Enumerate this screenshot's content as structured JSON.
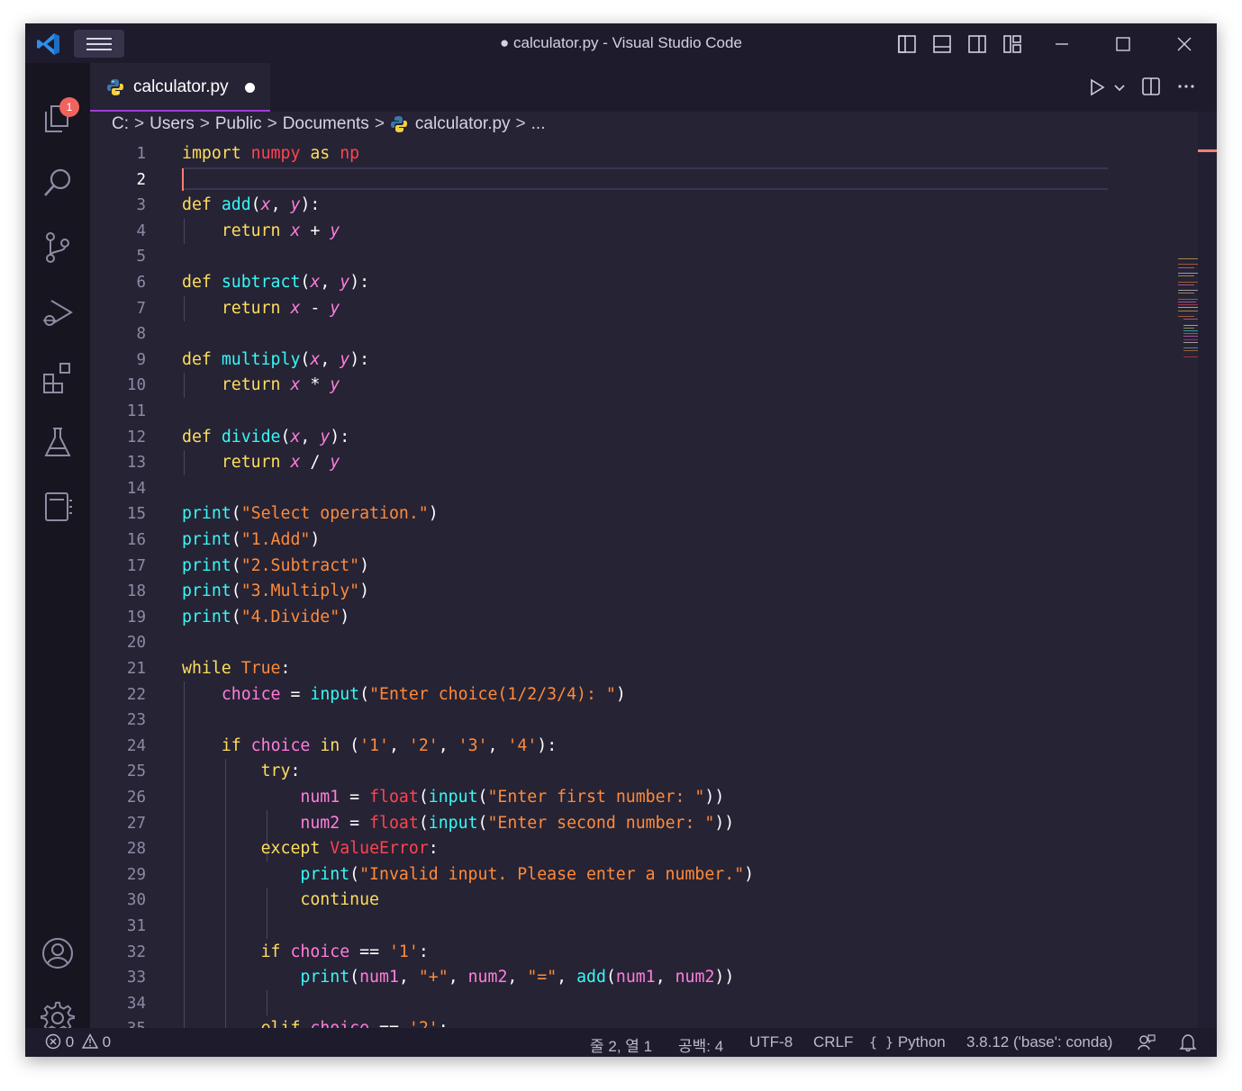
{
  "window": {
    "title": "● calculator.py - Visual Studio Code"
  },
  "activity_bar": {
    "explorer_badge": "1"
  },
  "tab": {
    "label": "calculator.py"
  },
  "breadcrumb": [
    "C:",
    "Users",
    "Public",
    "Documents",
    "calculator.py",
    "..."
  ],
  "editor": {
    "active_line": 2,
    "line_numbers": [
      "1",
      "2",
      "3",
      "4",
      "5",
      "6",
      "7",
      "8",
      "9",
      "10",
      "11",
      "12",
      "13",
      "14",
      "15",
      "16",
      "17",
      "18",
      "19",
      "20",
      "21",
      "22",
      "23",
      "24",
      "25",
      "26",
      "27",
      "28",
      "29",
      "30",
      "31",
      "32",
      "33",
      "34",
      "35"
    ]
  },
  "statusbar": {
    "errors": "0",
    "warnings": "0",
    "position": "줄 2, 열 1",
    "spaces": "공백: 4",
    "encoding": "UTF-8",
    "eol": "CRLF",
    "language": "Python",
    "interpreter": "3.8.12 ('base': conda)"
  },
  "colors": {
    "background": "#262335",
    "keyword": "#fede5d",
    "function": "#36f9f6",
    "string": "#ff8b39",
    "parameter": "#ff7edb",
    "module": "#fe4450",
    "accent": "#a03cd6"
  },
  "icons": [
    "vscode-logo-icon",
    "menu-icon",
    "layout-sidebar-left-icon",
    "layout-panel-icon",
    "layout-sidebar-right-icon",
    "layout-customize-icon",
    "minimize-icon",
    "maximize-icon",
    "close-icon",
    "files-icon",
    "search-icon",
    "source-control-icon",
    "run-debug-icon",
    "extensions-icon",
    "testing-icon",
    "notebook-icon",
    "account-icon",
    "gear-icon",
    "python-icon",
    "run-icon",
    "chevron-down-icon",
    "split-editor-icon",
    "more-icon",
    "error-icon",
    "warning-icon",
    "braces-icon",
    "feedback-icon",
    "bell-icon"
  ]
}
